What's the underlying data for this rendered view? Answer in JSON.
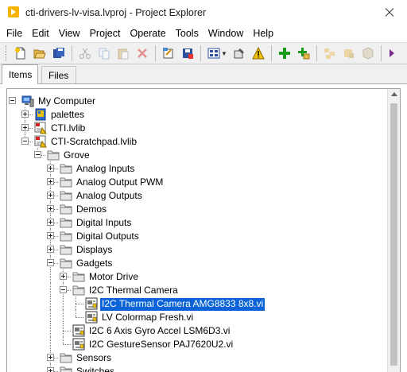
{
  "window": {
    "title": "cti-drivers-lv-visa.lvproj - Project Explorer"
  },
  "menu": [
    "File",
    "Edit",
    "View",
    "Project",
    "Operate",
    "Tools",
    "Window",
    "Help"
  ],
  "toolbar": {
    "buttons": [
      "new-icon",
      "open-icon",
      "save-all-icon",
      "cut-icon",
      "copy-icon",
      "paste-icon",
      "delete-icon",
      "build-icon",
      "save-icon",
      "view-icon",
      "properties-icon",
      "warning-icon",
      "add-item-icon",
      "add-folder-icon",
      "expand-icon",
      "collapse-icon",
      "cube-icon",
      "more-icon"
    ],
    "colors": {
      "add": "#1a9a1a",
      "warning": "#f2c200"
    }
  },
  "tabs": [
    {
      "label": "Items",
      "active": true
    },
    {
      "label": "Files",
      "active": false
    }
  ],
  "tree": {
    "items": [
      {
        "label": "My Computer",
        "icon": "computer-icon",
        "expanded": true
      },
      {
        "label": "palettes",
        "icon": "palette-library-icon",
        "expanded": false
      },
      {
        "label": "CTI.lvlib",
        "icon": "library-icon",
        "expanded": false
      },
      {
        "label": "CTI-Scratchpad.lvlib",
        "icon": "library-icon",
        "expanded": true
      },
      {
        "label": "Grove",
        "icon": "folder-icon",
        "expanded": true
      },
      {
        "label": "Analog Inputs",
        "icon": "folder-icon",
        "expanded": false
      },
      {
        "label": "Analog Output PWM",
        "icon": "folder-icon",
        "expanded": false
      },
      {
        "label": "Analog Outputs",
        "icon": "folder-icon",
        "expanded": false
      },
      {
        "label": "Demos",
        "icon": "folder-icon",
        "expanded": false
      },
      {
        "label": "Digital Inputs",
        "icon": "folder-icon",
        "expanded": false
      },
      {
        "label": "Digital Outputs",
        "icon": "folder-icon",
        "expanded": false
      },
      {
        "label": "Displays",
        "icon": "folder-icon",
        "expanded": false
      },
      {
        "label": "Gadgets",
        "icon": "folder-icon",
        "expanded": true
      },
      {
        "label": "Motor Drive",
        "icon": "folder-icon",
        "expanded": false
      },
      {
        "label": "I2C Thermal Camera",
        "icon": "folder-icon",
        "expanded": true
      },
      {
        "label": "I2C Thermal Camera AMG8833 8x8.vi",
        "icon": "vi-icon",
        "selected": true
      },
      {
        "label": "LV Colormap Fresh.vi",
        "icon": "vi-icon"
      },
      {
        "label": "I2C 6 Axis Gyro Accel LSM6D3.vi",
        "icon": "vi-icon"
      },
      {
        "label": "I2C GestureSensor PAJ7620U2.vi",
        "icon": "vi-icon"
      },
      {
        "label": "Sensors",
        "icon": "folder-icon",
        "expanded": false
      },
      {
        "label": "Switches",
        "icon": "folder-icon",
        "expanded": false
      }
    ],
    "selection_color": "#0a64d8"
  }
}
